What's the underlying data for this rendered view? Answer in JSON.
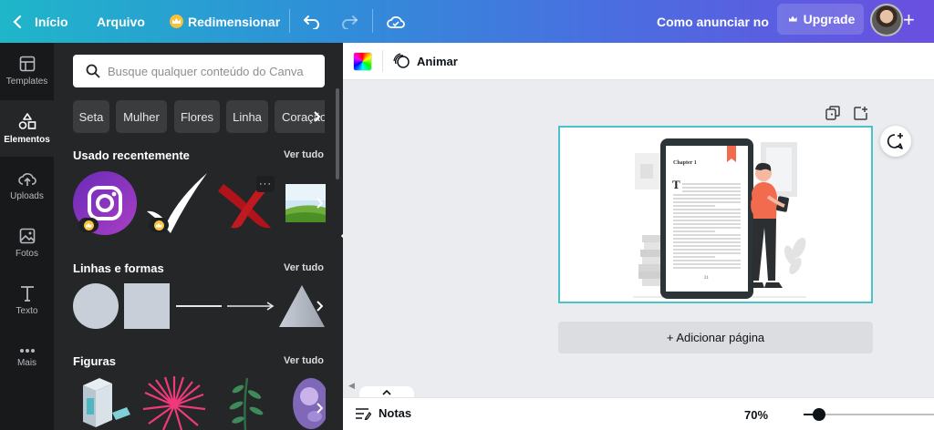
{
  "topbar": {
    "home_label": "Início",
    "file_label": "Arquivo",
    "resize_label": "Redimensionar",
    "promo_link": "Como anunciar no",
    "upgrade_label": "Upgrade"
  },
  "rail": {
    "items": [
      {
        "label": "Templates",
        "icon": "templates-icon"
      },
      {
        "label": "Elementos",
        "icon": "elements-icon"
      },
      {
        "label": "Uploads",
        "icon": "upload-cloud-icon"
      },
      {
        "label": "Fotos",
        "icon": "photo-icon"
      },
      {
        "label": "Texto",
        "icon": "text-icon"
      },
      {
        "label": "Mais",
        "icon": "more-dots-icon"
      }
    ],
    "active": "Elementos"
  },
  "panel": {
    "search_placeholder": "Busque qualquer conteúdo do Canva",
    "chips": [
      "Seta",
      "Mulher",
      "Flores",
      "Linha",
      "Coração"
    ],
    "sections": [
      {
        "title": "Usado recentemente",
        "see_all": "Ver tudo"
      },
      {
        "title": "Linhas e formas",
        "see_all": "Ver tudo"
      },
      {
        "title": "Figuras",
        "see_all": "Ver tudo"
      }
    ]
  },
  "toolbar": {
    "animate_label": "Animar"
  },
  "canvas": {
    "add_page_label": "+ Adicionar página",
    "book_chapter": "Chapter 1",
    "book_letter": "T",
    "book_page_number": "21"
  },
  "bottombar": {
    "notes_label": "Notas",
    "zoom_label": "70%",
    "zoom_value": 0.12
  },
  "colors": {
    "accent": "#49c2cc",
    "panel_bg": "#252627",
    "rail_bg": "#18191b",
    "instagram": "#8a3ab9",
    "figure_orange": "#f26b4f"
  }
}
